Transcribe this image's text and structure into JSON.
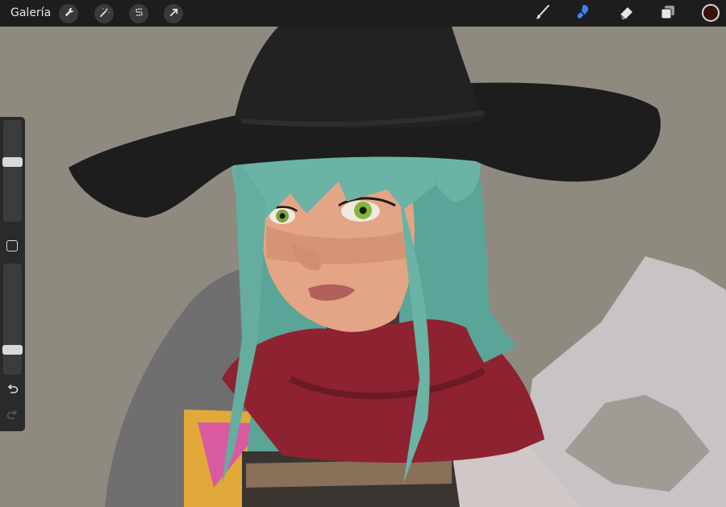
{
  "toolbar": {
    "gallery_label": "Galería",
    "left_tools": [
      "wrench-icon",
      "magic-wand-icon",
      "selection-s-icon",
      "transform-arrow-icon"
    ],
    "right_tools": [
      "brush-icon",
      "smudge-icon",
      "eraser-icon",
      "layers-icon"
    ],
    "active_tool": "smudge-icon",
    "current_color": "#3a1208",
    "accent_color": "#3b82f6"
  },
  "sidebar": {
    "brush_size_level": 0.6,
    "opacity_level": 0.2,
    "buttons": [
      "undo-icon",
      "redo-icon"
    ]
  },
  "canvas": {
    "background_color": "#8f8a80"
  }
}
